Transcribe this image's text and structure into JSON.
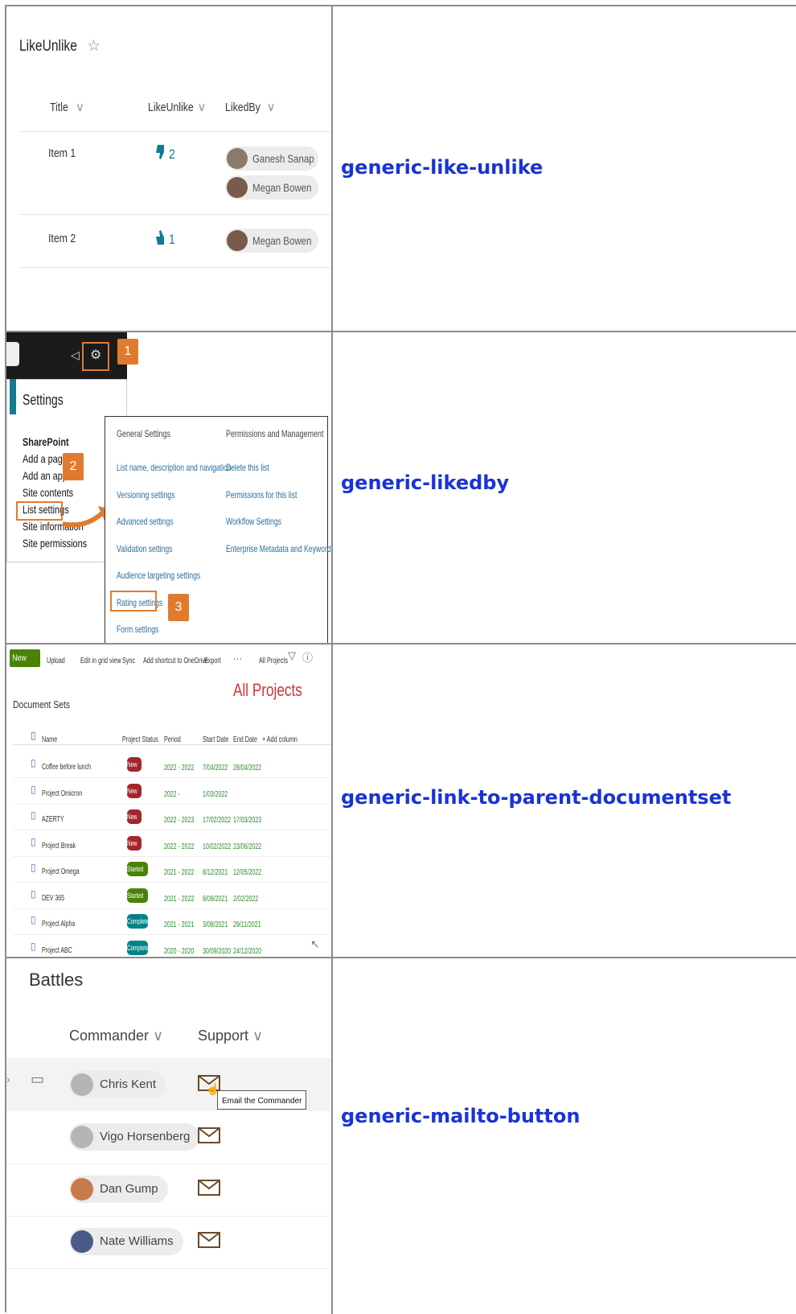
{
  "rows": [
    {
      "link": "generic-like-unlike"
    },
    {
      "link": "generic-likedby"
    },
    {
      "link": "generic-link-to-parent-documentset"
    },
    {
      "link": "generic-mailto-button"
    }
  ],
  "likeunlike": {
    "title": "LikeUnlike",
    "star": "☆",
    "columns": [
      "Title",
      "LikeUnlike",
      "LikedBy"
    ],
    "items": [
      {
        "title": "Item 1",
        "count": "2",
        "thumb": "thumb-down",
        "likedby": [
          "Ganesh Sanap",
          "Megan Bowen"
        ]
      },
      {
        "title": "Item 2",
        "count": "1",
        "thumb": "thumb-up",
        "likedby": [
          "Megan Bowen"
        ]
      }
    ]
  },
  "likedby": {
    "settings_title": "Settings",
    "sharepoint": "SharePoint",
    "menu": [
      "Add a page",
      "Add an app",
      "Site contents",
      "List settings",
      "Site information",
      "Site permissions"
    ],
    "badges": [
      "1",
      "2",
      "3"
    ],
    "general_header": "General Settings",
    "perm_header": "Permissions and Management",
    "general_links": [
      "List name, description and navigation",
      "Versioning settings",
      "Advanced settings",
      "Validation settings",
      "Audience targeting settings",
      "Rating settings",
      "Form settings"
    ],
    "perm_links": [
      "Delete this list",
      "Permissions for this list",
      "Workflow Settings",
      "Enterprise Metadata and Keywords Settings"
    ]
  },
  "docset": {
    "toolbar": {
      "new": "New",
      "upload": "Upload",
      "edit_grid": "Edit in grid view",
      "sync": "Sync",
      "shortcut": "Add shortcut to OneDrive",
      "export": "Export",
      "more": "···",
      "view": "All Projects"
    },
    "big_title": "All Projects",
    "breadcrumb": "Document Sets",
    "columns": [
      "Name",
      "Project Status",
      "Period",
      "Start Date",
      "End Date",
      "+ Add column"
    ],
    "rows": [
      {
        "name": "Coffee before lunch",
        "status": "New",
        "period": "2022 - 2022",
        "start": "7/04/2022",
        "end": "28/04/2022"
      },
      {
        "name": "Project Omicron",
        "status": "New",
        "period": "2022 -",
        "start": "1/03/2022",
        "end": ""
      },
      {
        "name": "AZERTY",
        "status": "New",
        "period": "2022 - 2023",
        "start": "17/02/2022",
        "end": "17/03/2023"
      },
      {
        "name": "Project Break",
        "status": "New",
        "period": "2022 - 2022",
        "start": "10/02/2022",
        "end": "23/06/2022"
      },
      {
        "name": "Project Omega",
        "status": "Started",
        "period": "2021 - 2022",
        "start": "8/12/2021",
        "end": "12/05/2022"
      },
      {
        "name": "DEV 365",
        "status": "Started",
        "period": "2021 - 2022",
        "start": "8/09/2021",
        "end": "2/02/2022"
      },
      {
        "name": "Project Alpha",
        "status": "Completed",
        "period": "2021 - 2021",
        "start": "3/08/2021",
        "end": "29/11/2021"
      },
      {
        "name": "Project ABC",
        "status": "Completed",
        "period": "2020 - 2020",
        "start": "30/09/2020",
        "end": "24/12/2020"
      }
    ],
    "status_colors": {
      "New": "#a4262c",
      "Started": "#498205",
      "Completed": "#038387"
    }
  },
  "battles": {
    "title": "Battles",
    "columns": [
      "Commander",
      "Support"
    ],
    "people": [
      "Chris Kent",
      "Vigo Horsenberg",
      "Dan Gump",
      "Nate Williams"
    ],
    "tooltip": "Email the Commander"
  },
  "colors": {
    "link": "#1a33d6",
    "accent_orange": "#e07b2e",
    "sp_green": "#498205"
  }
}
